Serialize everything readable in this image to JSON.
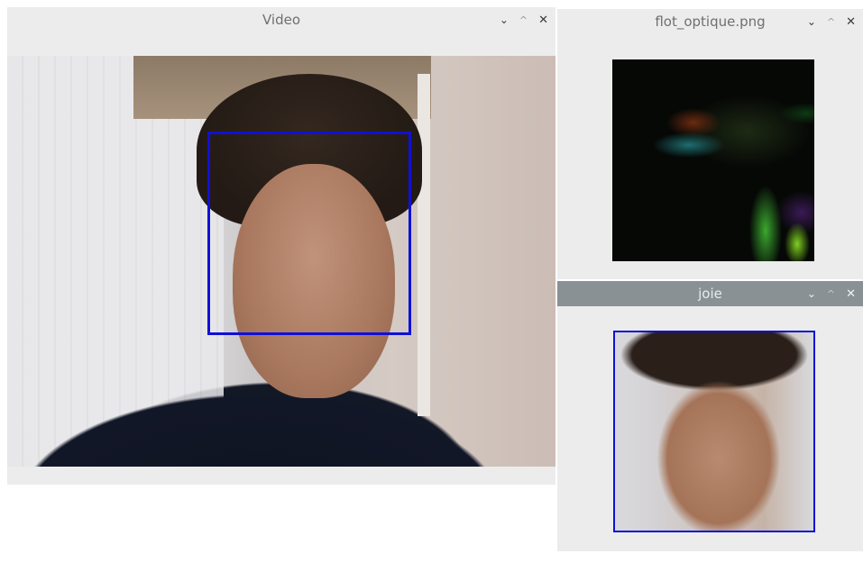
{
  "video_window": {
    "title": "Video",
    "controls": {
      "minimize": "⌄",
      "maximize": "^",
      "close": "✕"
    }
  },
  "flow_window": {
    "title": "flot_optique.png",
    "controls": {
      "minimize": "⌄",
      "maximize": "^",
      "close": "✕"
    }
  },
  "joie_window": {
    "title": "joie",
    "controls": {
      "minimize": "⌄",
      "maximize": "^",
      "close": "✕"
    }
  },
  "colors": {
    "face_box": "#1010d8",
    "active_titlebar": "#8a9195",
    "window_bg": "#ececec"
  }
}
